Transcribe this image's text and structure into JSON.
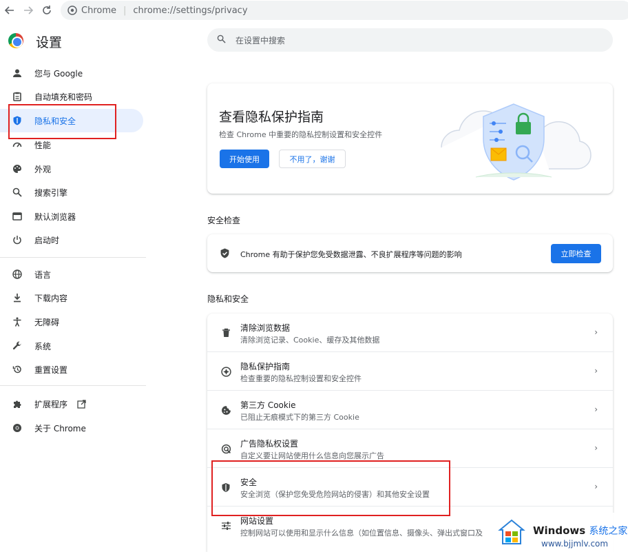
{
  "browser": {
    "site_label": "Chrome",
    "url": "chrome://settings/privacy"
  },
  "app": {
    "title": "设置"
  },
  "sidebar": {
    "items": [
      {
        "label": "您与 Google",
        "icon": "person-icon"
      },
      {
        "label": "自动填充和密码",
        "icon": "clipboard-icon"
      },
      {
        "label": "隐私和安全",
        "icon": "shield-icon"
      },
      {
        "label": "性能",
        "icon": "speedometer-icon"
      },
      {
        "label": "外观",
        "icon": "palette-icon"
      },
      {
        "label": "搜索引擎",
        "icon": "search-icon"
      },
      {
        "label": "默认浏览器",
        "icon": "browser-icon"
      },
      {
        "label": "启动时",
        "icon": "power-icon"
      },
      {
        "label": "语言",
        "icon": "globe-icon"
      },
      {
        "label": "下载内容",
        "icon": "download-icon"
      },
      {
        "label": "无障碍",
        "icon": "accessibility-icon"
      },
      {
        "label": "系统",
        "icon": "wrench-icon"
      },
      {
        "label": "重置设置",
        "icon": "restore-icon"
      },
      {
        "label": "扩展程序",
        "icon": "puzzle-icon"
      },
      {
        "label": "关于 Chrome",
        "icon": "chrome-icon"
      }
    ]
  },
  "search": {
    "placeholder": "在设置中搜索"
  },
  "promo": {
    "title": "查看隐私保护指南",
    "description": "检查 Chrome 中重要的隐私控制设置和安全控件",
    "start_label": "开始使用",
    "dismiss_label": "不用了，谢谢"
  },
  "safety_check": {
    "section_title": "安全检查",
    "text": "Chrome 有助于保护您免受数据泄露、不良扩展程序等问题的影响",
    "button_label": "立即检查"
  },
  "privacy": {
    "section_title": "隐私和安全",
    "rows": [
      {
        "title": "清除浏览数据",
        "subtitle": "清除浏览记录、Cookie、缓存及其他数据",
        "icon": "trash-icon"
      },
      {
        "title": "隐私保护指南",
        "subtitle": "检查重要的隐私控制设置和安全控件",
        "icon": "compass-icon"
      },
      {
        "title": "第三方 Cookie",
        "subtitle": "已阻止无痕模式下的第三方 Cookie",
        "icon": "cookie-icon"
      },
      {
        "title": "广告隐私权设置",
        "subtitle": "自定义要让网站使用什么信息向您展示广告",
        "icon": "ad-privacy-icon"
      },
      {
        "title": "安全",
        "subtitle": "安全浏览（保护您免受危险网站的侵害）和其他安全设置",
        "icon": "security-shield-icon"
      },
      {
        "title": "网站设置",
        "subtitle": "控制网站可以使用和显示什么信息（如位置信息、摄像头、弹出式窗口及",
        "icon": "sliders-icon"
      }
    ]
  },
  "watermark": {
    "brand": "Windows",
    "brand_suffix": "系统之家",
    "url": "www.bjjmlv.com"
  },
  "colors": {
    "accent": "#1a73e8",
    "active_bg": "#e8f0fe",
    "highlight_box": "#e02020"
  }
}
